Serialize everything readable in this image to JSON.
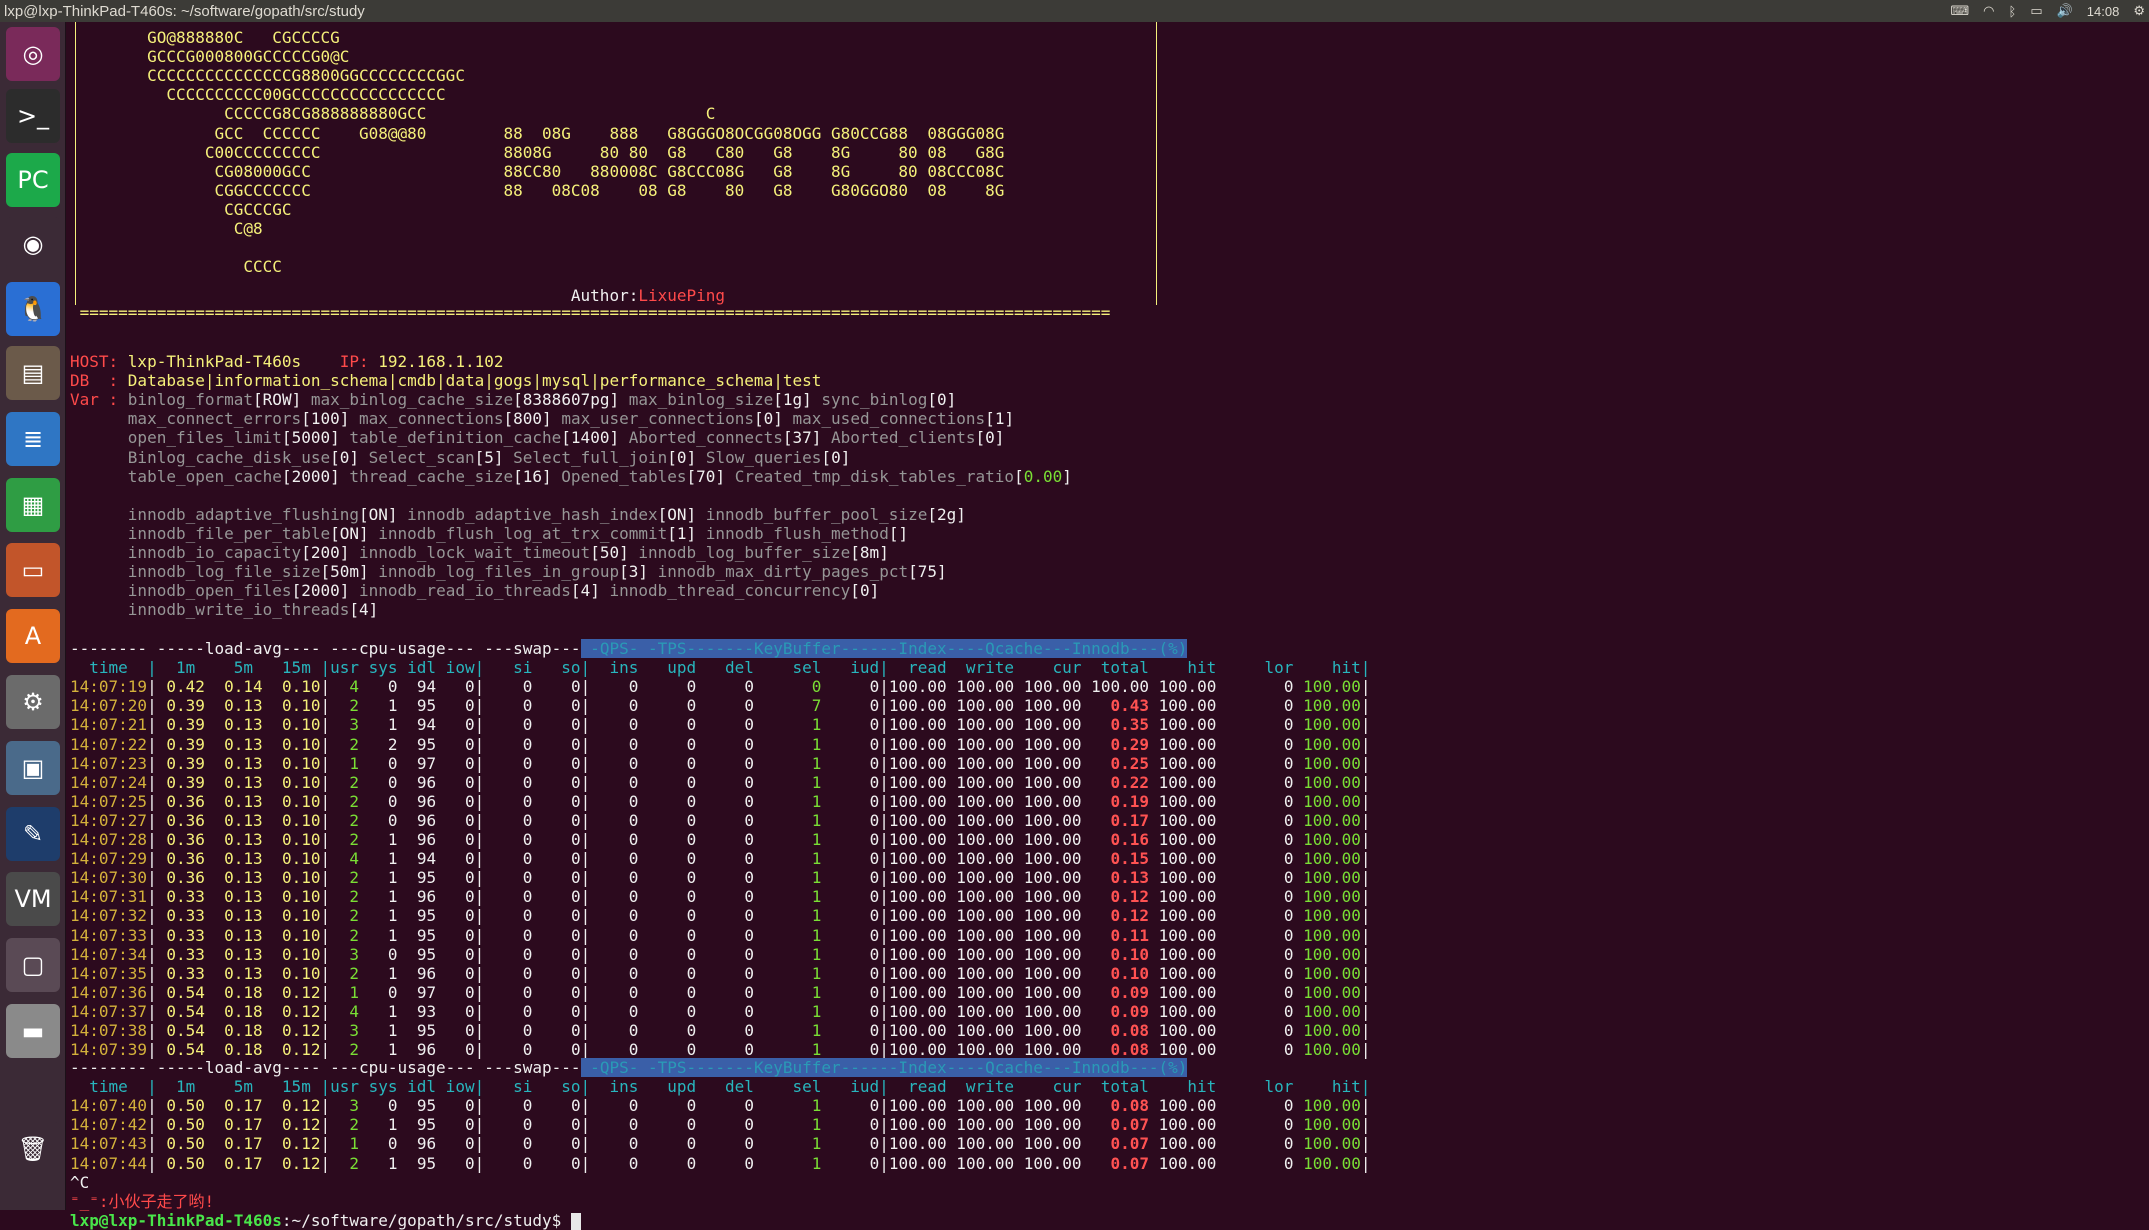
{
  "window": {
    "title": "lxp@lxp-ThinkPad-T460s: ~/software/gopath/src/study",
    "clock": "14:08"
  },
  "tray_icons": [
    "keyboard-icon",
    "wifi-icon",
    "bluetooth-icon",
    "battery-icon",
    "volume-icon",
    "clock",
    "settings-gear-icon"
  ],
  "launcher": {
    "items": [
      {
        "name": "ubuntu-dash-icon",
        "glyph": "◎",
        "bg": "#7a2a5a"
      },
      {
        "name": "terminal-icon",
        "glyph": ">_",
        "bg": "#2c2c2c"
      },
      {
        "name": "pycharm-icon",
        "glyph": "PC",
        "bg": "#1ca94a"
      },
      {
        "name": "chrome-icon",
        "glyph": "◉",
        "bg": "#3b2a36"
      },
      {
        "name": "qq-penguin-icon",
        "glyph": "🐧",
        "bg": "#2a6fd4"
      },
      {
        "name": "files-icon",
        "glyph": "▤",
        "bg": "#6b5a4a"
      },
      {
        "name": "writer-document-icon",
        "glyph": "≣",
        "bg": "#2f76c4"
      },
      {
        "name": "calc-spreadsheet-icon",
        "glyph": "▦",
        "bg": "#2f9d44"
      },
      {
        "name": "impress-presentation-icon",
        "glyph": "▭",
        "bg": "#c2552a"
      },
      {
        "name": "software-center-icon",
        "glyph": "A",
        "bg": "#e36a1f"
      },
      {
        "name": "system-settings-icon",
        "glyph": "⚙",
        "bg": "#6b6b6b"
      },
      {
        "name": "remote-desktop-icon",
        "glyph": "▣",
        "bg": "#4a6a8a"
      },
      {
        "name": "pen-tool-icon",
        "glyph": "✎",
        "bg": "#1e3d6b"
      },
      {
        "name": "vm-icon",
        "glyph": "VM",
        "bg": "#4a4a4a"
      },
      {
        "name": "workspace-switcher-icon",
        "glyph": "▢",
        "bg": "#5a4a55"
      },
      {
        "name": "drive-icon",
        "glyph": "▬",
        "bg": "#8a8a8a"
      },
      {
        "name": "trash-icon",
        "glyph": "🗑",
        "bg": "#3b2a36"
      }
    ]
  },
  "banner": [
    "        GO@888880C   CGCCCCG",
    "        GCCCG000800GCCCCCG0@C",
    "        CCCCCCCCCCCCCCCG8800GGCCCCCCCCGGC",
    "          CCCCCCCCCC00GCCCCCCCCCCCCCCCC",
    "                CCCCCG8CG888888880GCC                             C",
    "               GCC  CCCCCC    G08@@80        88  08G    888   G8GGGO8OCGG08OGG G80CCG88  08GGG08G",
    "              C00CCCCCCCCC                   8808G     80 80  G8   C80   G8    8G     80 08   G8G",
    "               CG08000GCC                    88CC80   880008C G8CCC08G   G8    8G     80 08CCC08C",
    "               CGGCCCCCCC                    88   08C08    08 G8    80   G8    G80GGO80  08    8G",
    "                CGCCCGC",
    "                 C@8",
    "",
    "                  CCCC"
  ],
  "author_label": "Author:",
  "author_name": "LixuePing",
  "info": {
    "host_key": "HOST:",
    "host": "lxp-ThinkPad-T460s",
    "ip_key": "IP:",
    "ip": "192.168.1.102",
    "db_key": "DB  :",
    "db": "Database|information_schema|cmdb|data|gogs|mysql|performance_schema|test",
    "var_key": "Var :",
    "var_lines": [
      [
        [
          "binlog_format",
          "ROW"
        ],
        [
          "max_binlog_cache_size",
          "8388607pg"
        ],
        [
          "max_binlog_size",
          "1g"
        ],
        [
          "sync_binlog",
          "0"
        ]
      ],
      [
        [
          "max_connect_errors",
          "100"
        ],
        [
          "max_connections",
          "800"
        ],
        [
          "max_user_connections",
          "0"
        ],
        [
          "max_used_connections",
          "1"
        ]
      ],
      [
        [
          "open_files_limit",
          "5000"
        ],
        [
          "table_definition_cache",
          "1400"
        ],
        [
          "Aborted_connects",
          "37"
        ],
        [
          "Aborted_clients",
          "0"
        ]
      ],
      [
        [
          "Binlog_cache_disk_use",
          "0"
        ],
        [
          "Select_scan",
          "5"
        ],
        [
          "Select_full_join",
          "0"
        ],
        [
          "Slow_queries",
          "0"
        ]
      ],
      [
        [
          "table_open_cache",
          "2000"
        ],
        [
          "thread_cache_size",
          "16"
        ],
        [
          "Opened_tables",
          "70"
        ],
        [
          "Created_tmp_disk_tables_ratio",
          "0.00"
        ]
      ],
      [],
      [
        [
          "innodb_adaptive_flushing",
          "ON"
        ],
        [
          "innodb_adaptive_hash_index",
          "ON"
        ],
        [
          "innodb_buffer_pool_size",
          "2g"
        ]
      ],
      [
        [
          "innodb_file_per_table",
          "ON"
        ],
        [
          "innodb_flush_log_at_trx_commit",
          "1"
        ],
        [
          "innodb_flush_method",
          ""
        ]
      ],
      [
        [
          "innodb_io_capacity",
          "200"
        ],
        [
          "innodb_lock_wait_timeout",
          "50"
        ],
        [
          "innodb_log_buffer_size",
          "8m"
        ]
      ],
      [
        [
          "innodb_log_file_size",
          "50m"
        ],
        [
          "innodb_log_files_in_group",
          "3"
        ],
        [
          "innodb_max_dirty_pages_pct",
          "75"
        ]
      ],
      [
        [
          "innodb_open_files",
          "2000"
        ],
        [
          "innodb_read_io_threads",
          "4"
        ],
        [
          "innodb_thread_concurrency",
          "0"
        ]
      ],
      [
        [
          "innodb_write_io_threads",
          "4"
        ]
      ]
    ]
  },
  "header_groups": "-------- -----load-avg---- ---cpu-usage--- ---swap---",
  "header_groups_right": " -QPS- -TPS-------KeyBuffer------Index----Qcache---Innodb---(%)",
  "header_cols": "  time  |  1m    5m   15m |usr sys idl iow|   si   so|",
  "header_cols_right": "  ins   upd   del    sel   iud|  read  write    cur  total    hit     lor    hit|",
  "rows": [
    [
      "14:07:19",
      "0.42",
      "0.14",
      "0.10",
      "4",
      "0",
      "94",
      "0",
      "0",
      "0",
      "0",
      "0",
      "0",
      "0",
      "0",
      "100.00",
      "100.00",
      "100.00",
      "100.00",
      "100.00",
      "0",
      "100.00"
    ],
    [
      "14:07:20",
      "0.39",
      "0.13",
      "0.10",
      "2",
      "1",
      "95",
      "0",
      "0",
      "0",
      "0",
      "0",
      "0",
      "7",
      "0",
      "100.00",
      "100.00",
      "100.00",
      "0.43",
      "100.00",
      "0",
      "100.00"
    ],
    [
      "14:07:21",
      "0.39",
      "0.13",
      "0.10",
      "3",
      "1",
      "94",
      "0",
      "0",
      "0",
      "0",
      "0",
      "0",
      "1",
      "0",
      "100.00",
      "100.00",
      "100.00",
      "0.35",
      "100.00",
      "0",
      "100.00"
    ],
    [
      "14:07:22",
      "0.39",
      "0.13",
      "0.10",
      "2",
      "2",
      "95",
      "0",
      "0",
      "0",
      "0",
      "0",
      "0",
      "1",
      "0",
      "100.00",
      "100.00",
      "100.00",
      "0.29",
      "100.00",
      "0",
      "100.00"
    ],
    [
      "14:07:23",
      "0.39",
      "0.13",
      "0.10",
      "1",
      "0",
      "97",
      "0",
      "0",
      "0",
      "0",
      "0",
      "0",
      "1",
      "0",
      "100.00",
      "100.00",
      "100.00",
      "0.25",
      "100.00",
      "0",
      "100.00"
    ],
    [
      "14:07:24",
      "0.39",
      "0.13",
      "0.10",
      "2",
      "0",
      "96",
      "0",
      "0",
      "0",
      "0",
      "0",
      "0",
      "1",
      "0",
      "100.00",
      "100.00",
      "100.00",
      "0.22",
      "100.00",
      "0",
      "100.00"
    ],
    [
      "14:07:25",
      "0.36",
      "0.13",
      "0.10",
      "2",
      "0",
      "96",
      "0",
      "0",
      "0",
      "0",
      "0",
      "0",
      "1",
      "0",
      "100.00",
      "100.00",
      "100.00",
      "0.19",
      "100.00",
      "0",
      "100.00"
    ],
    [
      "14:07:27",
      "0.36",
      "0.13",
      "0.10",
      "2",
      "0",
      "96",
      "0",
      "0",
      "0",
      "0",
      "0",
      "0",
      "1",
      "0",
      "100.00",
      "100.00",
      "100.00",
      "0.17",
      "100.00",
      "0",
      "100.00"
    ],
    [
      "14:07:28",
      "0.36",
      "0.13",
      "0.10",
      "2",
      "1",
      "96",
      "0",
      "0",
      "0",
      "0",
      "0",
      "0",
      "1",
      "0",
      "100.00",
      "100.00",
      "100.00",
      "0.16",
      "100.00",
      "0",
      "100.00"
    ],
    [
      "14:07:29",
      "0.36",
      "0.13",
      "0.10",
      "4",
      "1",
      "94",
      "0",
      "0",
      "0",
      "0",
      "0",
      "0",
      "1",
      "0",
      "100.00",
      "100.00",
      "100.00",
      "0.15",
      "100.00",
      "0",
      "100.00"
    ],
    [
      "14:07:30",
      "0.36",
      "0.13",
      "0.10",
      "2",
      "1",
      "95",
      "0",
      "0",
      "0",
      "0",
      "0",
      "0",
      "1",
      "0",
      "100.00",
      "100.00",
      "100.00",
      "0.13",
      "100.00",
      "0",
      "100.00"
    ],
    [
      "14:07:31",
      "0.33",
      "0.13",
      "0.10",
      "2",
      "1",
      "96",
      "0",
      "0",
      "0",
      "0",
      "0",
      "0",
      "1",
      "0",
      "100.00",
      "100.00",
      "100.00",
      "0.12",
      "100.00",
      "0",
      "100.00"
    ],
    [
      "14:07:32",
      "0.33",
      "0.13",
      "0.10",
      "2",
      "1",
      "95",
      "0",
      "0",
      "0",
      "0",
      "0",
      "0",
      "1",
      "0",
      "100.00",
      "100.00",
      "100.00",
      "0.12",
      "100.00",
      "0",
      "100.00"
    ],
    [
      "14:07:33",
      "0.33",
      "0.13",
      "0.10",
      "2",
      "1",
      "95",
      "0",
      "0",
      "0",
      "0",
      "0",
      "0",
      "1",
      "0",
      "100.00",
      "100.00",
      "100.00",
      "0.11",
      "100.00",
      "0",
      "100.00"
    ],
    [
      "14:07:34",
      "0.33",
      "0.13",
      "0.10",
      "3",
      "0",
      "95",
      "0",
      "0",
      "0",
      "0",
      "0",
      "0",
      "1",
      "0",
      "100.00",
      "100.00",
      "100.00",
      "0.10",
      "100.00",
      "0",
      "100.00"
    ],
    [
      "14:07:35",
      "0.33",
      "0.13",
      "0.10",
      "2",
      "1",
      "96",
      "0",
      "0",
      "0",
      "0",
      "0",
      "0",
      "1",
      "0",
      "100.00",
      "100.00",
      "100.00",
      "0.10",
      "100.00",
      "0",
      "100.00"
    ],
    [
      "14:07:36",
      "0.54",
      "0.18",
      "0.12",
      "1",
      "0",
      "97",
      "0",
      "0",
      "0",
      "0",
      "0",
      "0",
      "1",
      "0",
      "100.00",
      "100.00",
      "100.00",
      "0.09",
      "100.00",
      "0",
      "100.00"
    ],
    [
      "14:07:37",
      "0.54",
      "0.18",
      "0.12",
      "4",
      "1",
      "93",
      "0",
      "0",
      "0",
      "0",
      "0",
      "0",
      "1",
      "0",
      "100.00",
      "100.00",
      "100.00",
      "0.09",
      "100.00",
      "0",
      "100.00"
    ],
    [
      "14:07:38",
      "0.54",
      "0.18",
      "0.12",
      "3",
      "1",
      "95",
      "0",
      "0",
      "0",
      "0",
      "0",
      "0",
      "1",
      "0",
      "100.00",
      "100.00",
      "100.00",
      "0.08",
      "100.00",
      "0",
      "100.00"
    ],
    [
      "14:07:39",
      "0.54",
      "0.18",
      "0.12",
      "2",
      "1",
      "96",
      "0",
      "0",
      "0",
      "0",
      "0",
      "0",
      "1",
      "0",
      "100.00",
      "100.00",
      "100.00",
      "0.08",
      "100.00",
      "0",
      "100.00"
    ]
  ],
  "rows2": [
    [
      "14:07:40",
      "0.50",
      "0.17",
      "0.12",
      "3",
      "0",
      "95",
      "0",
      "0",
      "0",
      "0",
      "0",
      "0",
      "1",
      "0",
      "100.00",
      "100.00",
      "100.00",
      "0.08",
      "100.00",
      "0",
      "100.00"
    ],
    [
      "14:07:42",
      "0.50",
      "0.17",
      "0.12",
      "2",
      "1",
      "95",
      "0",
      "0",
      "0",
      "0",
      "0",
      "0",
      "1",
      "0",
      "100.00",
      "100.00",
      "100.00",
      "0.07",
      "100.00",
      "0",
      "100.00"
    ],
    [
      "14:07:43",
      "0.50",
      "0.17",
      "0.12",
      "1",
      "0",
      "96",
      "0",
      "0",
      "0",
      "0",
      "0",
      "0",
      "1",
      "0",
      "100.00",
      "100.00",
      "100.00",
      "0.07",
      "100.00",
      "0",
      "100.00"
    ],
    [
      "14:07:44",
      "0.50",
      "0.17",
      "0.12",
      "2",
      "1",
      "95",
      "0",
      "0",
      "0",
      "0",
      "0",
      "0",
      "1",
      "0",
      "100.00",
      "100.00",
      "100.00",
      "0.07",
      "100.00",
      "0",
      "100.00"
    ]
  ],
  "ctrl_c": "^C",
  "farewell": "⁼_⁼:小伙子走了哟!",
  "prompt_user": "lxp@lxp-ThinkPad-T460s",
  "prompt_path": ":~/software/gopath/src/study$ "
}
